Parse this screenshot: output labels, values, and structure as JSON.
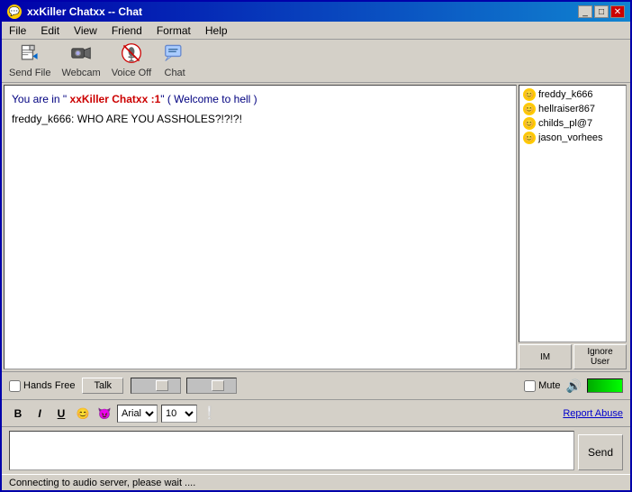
{
  "window": {
    "title": "xxKiller Chatxx  -- Chat",
    "icon": "💬"
  },
  "titlebar": {
    "minimize_label": "_",
    "maximize_label": "□",
    "close_label": "✕"
  },
  "menu": {
    "items": [
      "File",
      "Edit",
      "View",
      "Friend",
      "Format",
      "Help"
    ]
  },
  "toolbar": {
    "send_file_label": "Send File",
    "webcam_label": "Webcam",
    "voice_off_label": "Voice Off",
    "chat_label": "Chat"
  },
  "chat": {
    "welcome_prefix": "You are in \"",
    "room_name": " xxKiller Chatxx :1",
    "welcome_suffix": "\" ( Welcome to hell )",
    "messages": [
      {
        "user": "freddy_k666",
        "text": "freddy_k666: WHO ARE YOU ASSHOLES?!?!?!"
      }
    ]
  },
  "user_list": {
    "users": [
      "freddy_k666",
      "hellraiser867",
      "childs_pl@7",
      "jason_vorhees"
    ]
  },
  "user_list_buttons": {
    "im_label": "IM",
    "ignore_label": "Ignore User"
  },
  "audio_bar": {
    "hands_free_label": "Hands Free",
    "talk_label": "Talk",
    "mute_label": "Mute"
  },
  "format_bar": {
    "bold_label": "B",
    "italic_label": "I",
    "underline_label": "U",
    "font_name": "Arial",
    "font_size": "10",
    "exclaim_label": "❕",
    "report_abuse_label": "Report Abuse"
  },
  "input": {
    "placeholder": "",
    "send_label": "Send"
  },
  "status_bar": {
    "text": "Connecting to audio server, please wait ...."
  }
}
